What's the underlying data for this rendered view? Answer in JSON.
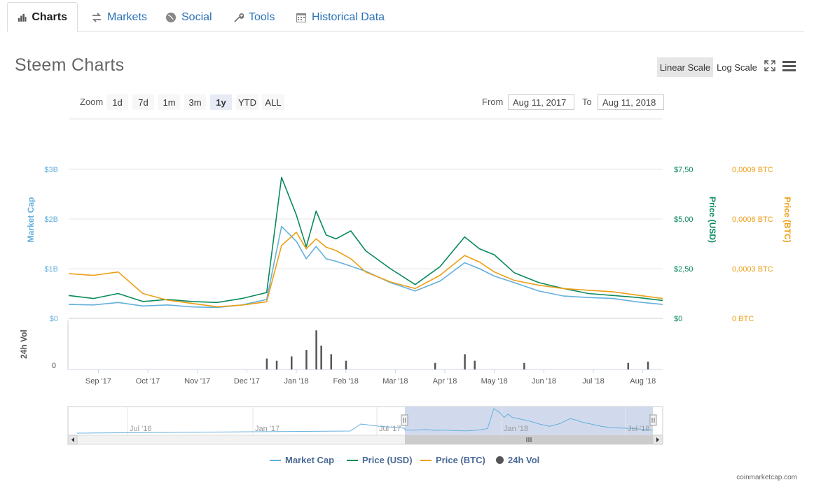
{
  "tabs": [
    {
      "label": "Charts",
      "icon": "bar-chart-icon",
      "active": true
    },
    {
      "label": "Markets",
      "icon": "exchange-arrows-icon",
      "active": false
    },
    {
      "label": "Social",
      "icon": "globe-icon",
      "active": false
    },
    {
      "label": "Tools",
      "icon": "wrench-icon",
      "active": false
    },
    {
      "label": "Historical Data",
      "icon": "calendar-icon",
      "active": false
    }
  ],
  "page_title": "Steem Charts",
  "scale": {
    "linear_label": "Linear Scale",
    "log_label": "Log Scale",
    "active": "linear"
  },
  "zoom": {
    "label": "Zoom",
    "options": [
      "1d",
      "7d",
      "1m",
      "3m",
      "1y",
      "YTD",
      "ALL"
    ],
    "active": "1y"
  },
  "range": {
    "from_label": "From",
    "from_value": "Aug 11, 2017",
    "to_label": "To",
    "to_value": "Aug 11, 2018"
  },
  "colors": {
    "market_cap": "#64b0dd",
    "price_usd": "#0a8a5a",
    "price_btc": "#ec9f15",
    "volume": "#555555",
    "navigator_mask": "#c9d4ea"
  },
  "chart_data": {
    "type": "line",
    "x_ticks": [
      "Sep '17",
      "Oct '17",
      "Nov '17",
      "Dec '17",
      "Jan '18",
      "Feb '18",
      "Mar '18",
      "Apr '18",
      "May '18",
      "Jun '18",
      "Jul '18",
      "Aug '18"
    ],
    "left_axis": {
      "label": "Market Cap",
      "ticks": [
        "$0",
        "$1B",
        "$2B",
        "$3B"
      ],
      "range": [
        0,
        3
      ]
    },
    "right_axis_usd": {
      "label": "Price (USD)",
      "ticks": [
        "$0",
        "$2,50",
        "$5,00",
        "$7,50"
      ],
      "range": [
        0,
        7.5
      ]
    },
    "right_axis_btc": {
      "label": "Price (BTC)",
      "ticks": [
        "0 BTC",
        "0,0003 BTC",
        "0,0006 BTC",
        "0,0009 BTC"
      ],
      "range": [
        0,
        0.0009
      ]
    },
    "volume_axis": {
      "label": "24h Vol",
      "ticks": [
        "0"
      ]
    },
    "months": [
      0,
      0.5,
      1,
      1.5,
      2,
      2.5,
      3,
      3.5,
      4,
      4.3,
      4.6,
      4.8,
      5,
      5.2,
      5.4,
      5.7,
      6,
      6.5,
      7,
      7.5,
      8,
      8.3,
      8.6,
      9,
      9.5,
      10,
      10.5,
      11,
      11.5,
      12
    ],
    "series": [
      {
        "name": "Market Cap",
        "axis": "left",
        "values": [
          0.28,
          0.27,
          0.32,
          0.25,
          0.27,
          0.23,
          0.22,
          0.27,
          0.38,
          1.85,
          1.55,
          1.2,
          1.45,
          1.2,
          1.15,
          1.05,
          0.95,
          0.72,
          0.55,
          0.75,
          1.12,
          1.0,
          0.85,
          0.72,
          0.55,
          0.45,
          0.42,
          0.4,
          0.33,
          0.28
        ]
      },
      {
        "name": "Price (USD)",
        "axis": "usd",
        "values": [
          1.15,
          1.0,
          1.25,
          0.85,
          0.95,
          0.85,
          0.8,
          1.0,
          1.3,
          7.1,
          5.2,
          3.6,
          5.4,
          4.2,
          4.0,
          4.4,
          3.4,
          2.5,
          1.7,
          2.6,
          4.1,
          3.5,
          3.2,
          2.3,
          1.8,
          1.5,
          1.25,
          1.15,
          1.05,
          0.9
        ]
      },
      {
        "name": "Price (BTC)",
        "axis": "btc",
        "values": [
          0.00027,
          0.00026,
          0.00028,
          0.00015,
          0.00011,
          9e-05,
          7e-05,
          8e-05,
          0.0001,
          0.00044,
          0.00052,
          0.00042,
          0.00048,
          0.00043,
          0.00041,
          0.00036,
          0.00028,
          0.00022,
          0.00018,
          0.00026,
          0.00038,
          0.00034,
          0.00028,
          0.00023,
          0.0002,
          0.00018,
          0.00017,
          0.00016,
          0.00014,
          0.00012
        ]
      }
    ],
    "volume_spikes": [
      {
        "month": 4.0,
        "height": 0.25
      },
      {
        "month": 4.2,
        "height": 0.2
      },
      {
        "month": 4.5,
        "height": 0.3
      },
      {
        "month": 4.8,
        "height": 0.45
      },
      {
        "month": 5.0,
        "height": 0.9
      },
      {
        "month": 5.1,
        "height": 0.55
      },
      {
        "month": 5.3,
        "height": 0.35
      },
      {
        "month": 5.6,
        "height": 0.2
      },
      {
        "month": 7.4,
        "height": 0.15
      },
      {
        "month": 8.0,
        "height": 0.35
      },
      {
        "month": 8.2,
        "height": 0.2
      },
      {
        "month": 9.2,
        "height": 0.15
      },
      {
        "month": 11.3,
        "height": 0.15
      },
      {
        "month": 11.7,
        "height": 0.18
      }
    ],
    "navigator": {
      "ticks": [
        "Jul '16",
        "Jan '17",
        "Jul '17",
        "Jan '18",
        "Jul '18"
      ]
    }
  },
  "legend": [
    {
      "label": "Market Cap",
      "type": "line",
      "color": "#64b0dd"
    },
    {
      "label": "Price (USD)",
      "type": "line",
      "color": "#0a8a5a"
    },
    {
      "label": "Price (BTC)",
      "type": "line",
      "color": "#ec9f15"
    },
    {
      "label": "24h Vol",
      "type": "dot",
      "color": "#555555"
    }
  ],
  "credit": "coinmarketcap.com"
}
